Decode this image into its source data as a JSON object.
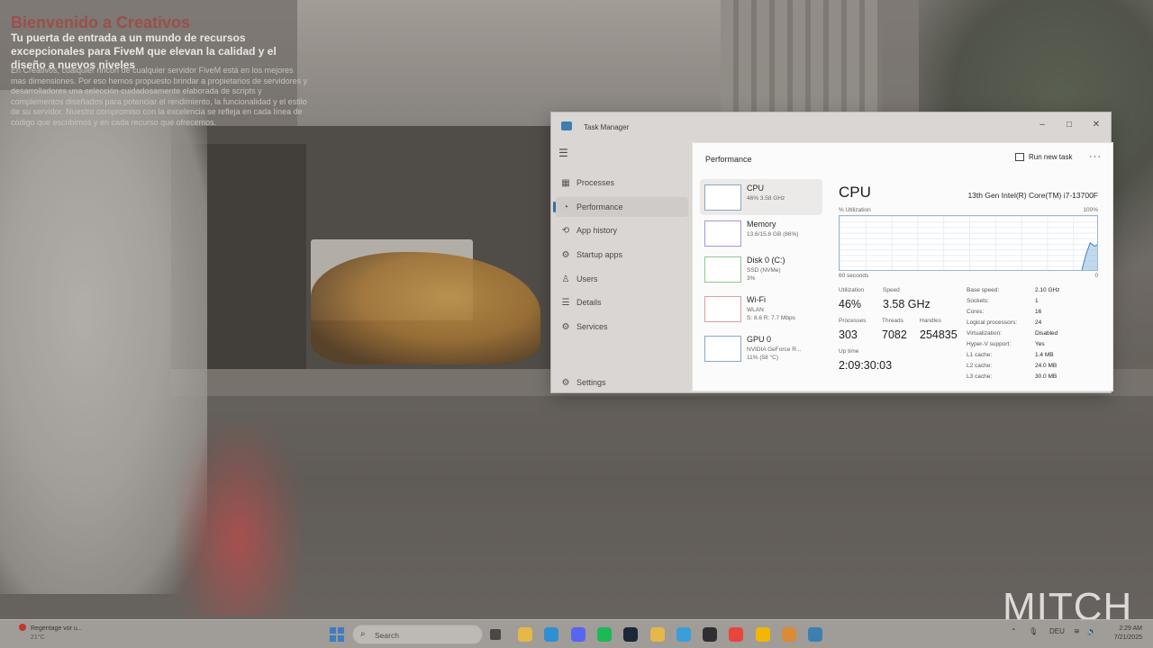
{
  "website": {
    "title": "Bienvenido a Creativos",
    "subtitle": "Tu puerta de entrada a un mundo de recursos excepcionales para FiveM que elevan la calidad y el diseño a nuevos niveles",
    "body": "En Creativos, cualquier rincón de cualquier servidor FiveM está en los mejores mas dimensiones. Por eso hemos propuesto brindar a propietarios de servidores y desarrolladores una selección cuidadosamente elaborada de scripts y complementos diseñados para potenciar el rendimiento, la funcionalidad y el estilo de su servidor. Nuestro compromiso con la excelencia se refleja en cada línea de código que escribimos y en cada recurso que ofrecemos.",
    "watermark": "MITCH"
  },
  "task_manager": {
    "window_title": "Task Manager",
    "controls": {
      "minimize": "–",
      "maximize": "□",
      "close": "✕"
    },
    "nav": [
      {
        "label": "Processes",
        "icon": "processes-icon",
        "glyph": "▦",
        "active": false
      },
      {
        "label": "Performance",
        "icon": "performance-icon",
        "glyph": "◔",
        "active": true
      },
      {
        "label": "App history",
        "icon": "app-history-icon",
        "glyph": "⟲",
        "active": false
      },
      {
        "label": "Startup apps",
        "icon": "startup-apps-icon",
        "glyph": "⚙",
        "active": false
      },
      {
        "label": "Users",
        "icon": "users-icon",
        "glyph": "♙",
        "active": false
      },
      {
        "label": "Details",
        "icon": "details-icon",
        "glyph": "☰",
        "active": false
      },
      {
        "label": "Services",
        "icon": "services-icon",
        "glyph": "⚙",
        "active": false
      }
    ],
    "settings_label": "Settings",
    "performance": {
      "title": "Performance",
      "run_new_task": "Run new task",
      "more": "···",
      "resources": [
        {
          "name": "CPU",
          "lines": [
            "46% 3.58 GHz"
          ],
          "color": "#4a90c8"
        },
        {
          "name": "Memory",
          "lines": [
            "13.6/15.8 GB (86%)"
          ],
          "color": "#8a6fc8"
        },
        {
          "name": "Disk 0 (C:)",
          "lines": [
            "SSD (NVMe)",
            "3%"
          ],
          "color": "#5aa85a"
        },
        {
          "name": "Wi-Fi",
          "lines": [
            "WLAN",
            "S: 8.6 R: 7.7 Mbps"
          ],
          "color": "#c87a7a"
        },
        {
          "name": "GPU 0",
          "lines": [
            "NVIDIA GeForce R...",
            "11% (58 °C)"
          ],
          "color": "#4a90c8"
        }
      ],
      "cpu": {
        "heading": "CPU",
        "model": "13th Gen Intel(R) Core(TM) i7-13700F",
        "util_label": "% Utilization",
        "util_max": "100%",
        "seconds_label": "60 seconds",
        "zero_label": "0",
        "utilization_history_pct": [
          0,
          0,
          0,
          0,
          0,
          0,
          0,
          0,
          0,
          0,
          0,
          0,
          0,
          0,
          0,
          0,
          0,
          0,
          0,
          0,
          0,
          0,
          0,
          0,
          0,
          0,
          0,
          0,
          0,
          0,
          0,
          0,
          0,
          0,
          0,
          0,
          0,
          0,
          0,
          0,
          0,
          0,
          0,
          0,
          0,
          0,
          0,
          0,
          0,
          0,
          0,
          0,
          0,
          0,
          0,
          0,
          30,
          52,
          46,
          50
        ],
        "stats": {
          "utilization": {
            "label": "Utilization",
            "value": "46%"
          },
          "speed": {
            "label": "Speed",
            "value": "3.58 GHz"
          },
          "processes": {
            "label": "Processes",
            "value": "303"
          },
          "threads": {
            "label": "Threads",
            "value": "7082"
          },
          "handles": {
            "label": "Handles",
            "value": "254835"
          },
          "uptime": {
            "label": "Up time",
            "value": "2:09:30:03"
          }
        },
        "specs": [
          {
            "key": "Base speed:",
            "value": "2.10 GHz"
          },
          {
            "key": "Sockets:",
            "value": "1"
          },
          {
            "key": "Cores:",
            "value": "16"
          },
          {
            "key": "Logical processors:",
            "value": "24"
          },
          {
            "key": "Virtualization:",
            "value": "Disabled"
          },
          {
            "key": "Hyper-V support:",
            "value": "Yes"
          },
          {
            "key": "L1 cache:",
            "value": "1.4 MB"
          },
          {
            "key": "L2 cache:",
            "value": "24.0 MB"
          },
          {
            "key": "L3 cache:",
            "value": "30.0 MB"
          }
        ]
      }
    }
  },
  "taskbar": {
    "weather_line1": "Regentage vor u...",
    "weather_line2": "21°C",
    "search_placeholder": "Search",
    "apps": [
      {
        "name": "file-explorer-icon",
        "color": "#e6b84a"
      },
      {
        "name": "edge-icon",
        "color": "#2f8fd0"
      },
      {
        "name": "discord-icon",
        "color": "#5865f2"
      },
      {
        "name": "spotify-icon",
        "color": "#1db954"
      },
      {
        "name": "steam-icon",
        "color": "#1b2838"
      },
      {
        "name": "folder-icon",
        "color": "#e6b84a"
      },
      {
        "name": "notepad-icon",
        "color": "#3a9fd8"
      },
      {
        "name": "obs-icon",
        "color": "#302e31"
      },
      {
        "name": "chrome-icon",
        "color": "#e8453c"
      },
      {
        "name": "chrome-alt-icon",
        "color": "#f2b705"
      },
      {
        "name": "app-icon",
        "color": "#d98b3a"
      },
      {
        "name": "task-manager-icon",
        "color": "#3c7fb0"
      }
    ],
    "language": "DEU",
    "time": "2:29 AM",
    "date": "7/21/2025"
  }
}
